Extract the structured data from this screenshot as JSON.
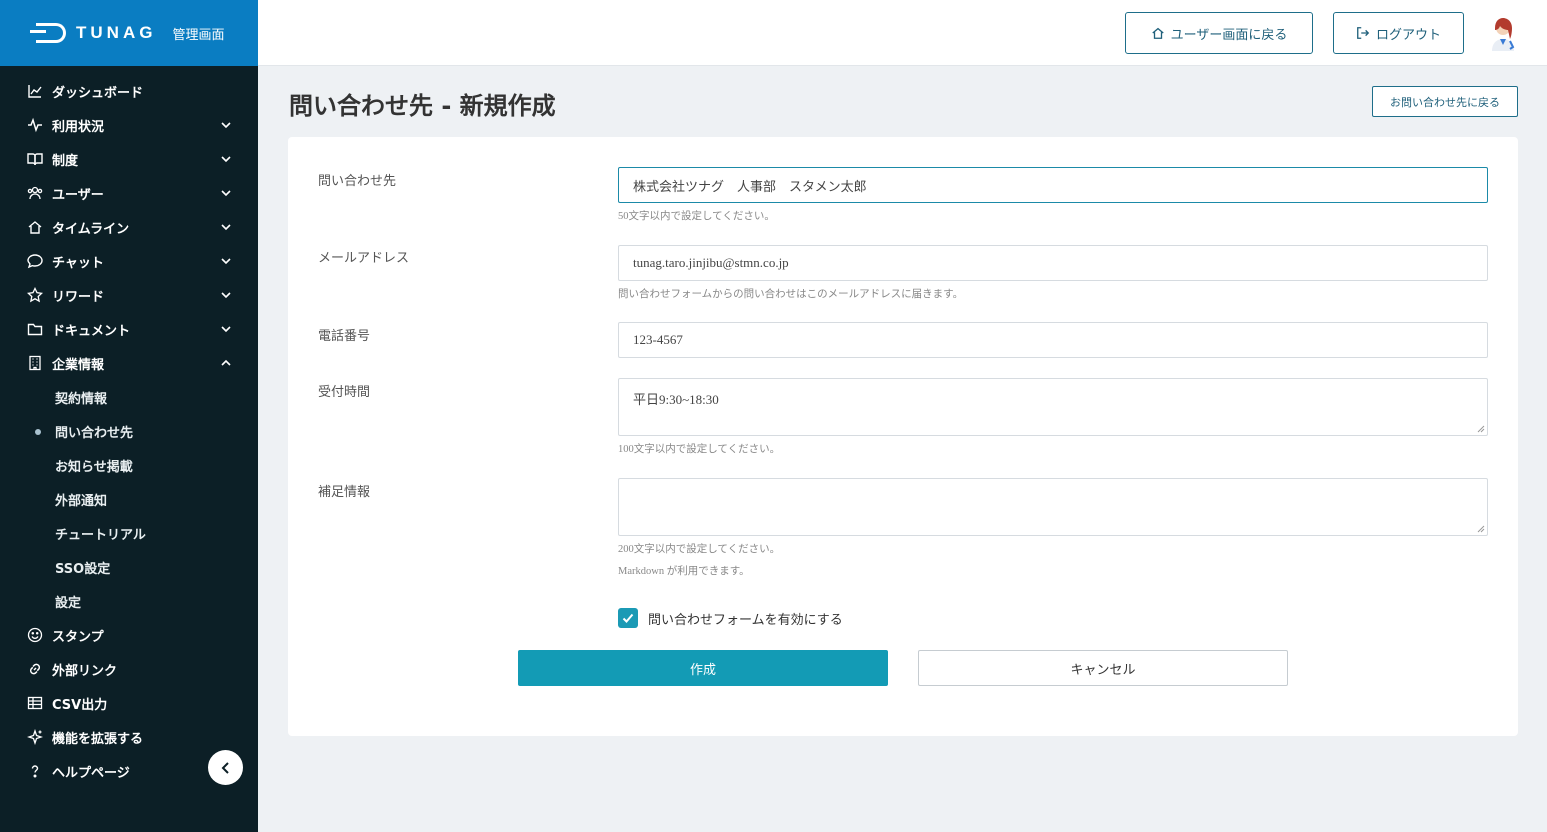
{
  "brand": {
    "name": "TUNAG",
    "sub": "管理画面"
  },
  "sidebar": {
    "items": [
      {
        "label": "ダッシュボード",
        "icon": "chart-line-icon",
        "chevron": ""
      },
      {
        "label": "利用状況",
        "icon": "pulse-icon",
        "chevron": "down"
      },
      {
        "label": "制度",
        "icon": "book-icon",
        "chevron": "down"
      },
      {
        "label": "ユーザー",
        "icon": "users-icon",
        "chevron": "down"
      },
      {
        "label": "タイムライン",
        "icon": "home-icon",
        "chevron": "down"
      },
      {
        "label": "チャット",
        "icon": "chat-icon",
        "chevron": "down"
      },
      {
        "label": "リワード",
        "icon": "star-icon",
        "chevron": "down"
      },
      {
        "label": "ドキュメント",
        "icon": "folder-icon",
        "chevron": "down"
      },
      {
        "label": "企業情報",
        "icon": "building-icon",
        "chevron": "up"
      }
    ],
    "sub_items": [
      "契約情報",
      "問い合わせ先",
      "お知らせ掲載",
      "外部通知",
      "チュートリアル",
      "SSO設定",
      "設定"
    ],
    "bottom_items": [
      {
        "label": "スタンプ",
        "icon": "smile-icon"
      },
      {
        "label": "外部リンク",
        "icon": "link-icon"
      },
      {
        "label": "CSV出力",
        "icon": "table-icon"
      },
      {
        "label": "機能を拡張する",
        "icon": "sparkle-icon"
      },
      {
        "label": "ヘルプページ",
        "icon": "help-icon"
      }
    ]
  },
  "header": {
    "user_screen_label": "ユーザー画面に戻る",
    "logout_label": "ログアウト"
  },
  "page": {
    "title": "問い合わせ先 - 新規作成",
    "back_label": "お問い合わせ先に戻る"
  },
  "form": {
    "contact_label": "問い合わせ先",
    "contact_value": "株式会社ツナグ　人事部　スタメン太郎",
    "contact_help": "50文字以内で設定してください。",
    "email_label": "メールアドレス",
    "email_value": "tunag.taro.jinjibu@stmn.co.jp",
    "email_help": "問い合わせフォームからの問い合わせはこのメールアドレスに届きます。",
    "phone_label": "電話番号",
    "phone_value": "123-4567",
    "hours_label": "受付時間",
    "hours_value": "平日9:30~18:30",
    "hours_help": "100文字以内で設定してください。",
    "extra_label": "補足情報",
    "extra_value": "",
    "extra_help1": "200文字以内で設定してください。",
    "extra_help2": "Markdown が利用できます。",
    "enable_form_label": "問い合わせフォームを有効にする",
    "enable_form_checked": true,
    "create_label": "作成",
    "cancel_label": "キャンセル"
  },
  "colors": {
    "brand": "#0a7dc2",
    "sidebar": "#0c1f26",
    "accent": "#139bb5"
  }
}
